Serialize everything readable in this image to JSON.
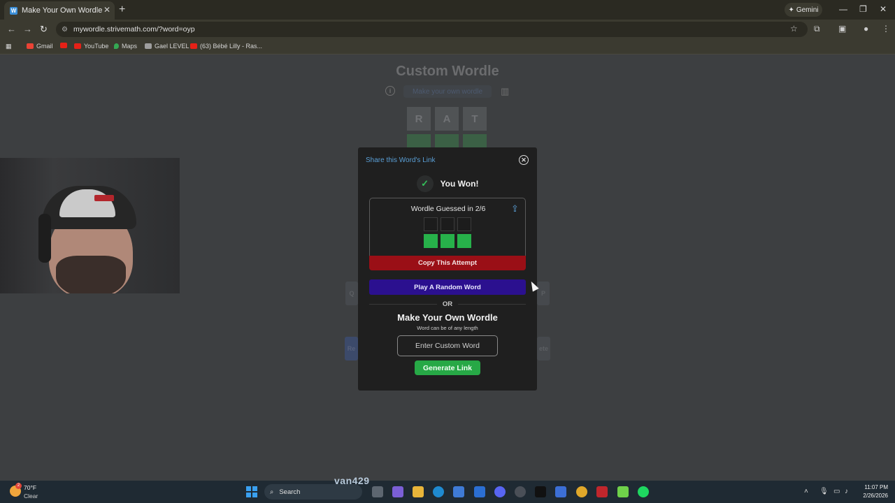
{
  "browser": {
    "tab_title": "Make Your Own Wordle",
    "favicon_letter": "W",
    "new_tab": "+",
    "tab_close": "✕",
    "gemini_label": "Gemini",
    "url": "mywordle.strivemath.com/?word=oyp",
    "bookmarks": [
      {
        "label": "Gmail",
        "color": "#ea4335"
      },
      {
        "label": "",
        "color": "#e62117"
      },
      {
        "label": "YouTube",
        "color": "#e62117"
      },
      {
        "label": "Maps",
        "color": "#34a853"
      },
      {
        "label": "Gael LEVEL",
        "color": "#9e9e9e"
      },
      {
        "label": "(63) Bébé Lilly - Ras...",
        "color": "#e62117"
      }
    ]
  },
  "page": {
    "title": "Custom Wordle",
    "subtitle": "Make your own wordle",
    "bg_row1": [
      "R",
      "A",
      "T"
    ],
    "bg_row2": [
      "",
      "",
      ""
    ],
    "bg_key_left": "Q",
    "bg_key_right": "P",
    "bg_enter": "Re",
    "bg_delete": "ete"
  },
  "modal": {
    "share_link_label": "Share this Word's Link",
    "close_glyph": "✕",
    "won_check": "✓",
    "won_text": "You Won!",
    "result_title": "Wordle Guessed in 2/6",
    "share_glyph": "⇪",
    "grid_rows": [
      [
        "empty",
        "empty",
        "empty"
      ],
      [
        "green",
        "green",
        "green"
      ]
    ],
    "copy_button": "Copy This Attempt",
    "random_button": "Play A Random Word",
    "or_label": "OR",
    "make_title": "Make Your Own Wordle",
    "make_subtitle": "Word can be of any length",
    "custom_placeholder": "Enter Custom Word",
    "generate_button": "Generate Link"
  },
  "taskbar": {
    "temp": "70°F",
    "condition": "Clear",
    "search_label": "Search",
    "time": "11:07 PM",
    "date": "2/26/2026",
    "overlay_name": "van429",
    "weather_badge": "2"
  },
  "colors": {
    "accent_green": "#27b14a",
    "copy_red": "#9a0f16",
    "random_blue": "#2b108f",
    "link_blue": "#5a9fd6"
  }
}
